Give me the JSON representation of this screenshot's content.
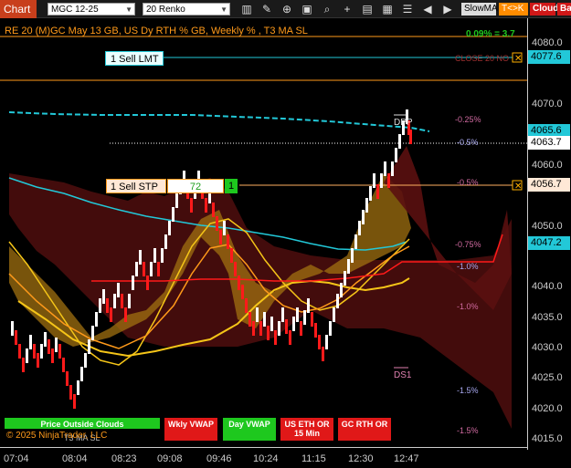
{
  "toolbar": {
    "title": "Chart",
    "instrument": "MGC 12-25",
    "bar_type": "20 Renko",
    "buttons": {
      "strategy": "SlowMA",
      "tk": "T<>K",
      "cloud": "Cloud",
      "bar": "Bar"
    }
  },
  "chart": {
    "header": "RE 20  (M)GC May 13 GB, US Dy RTH % GB, Weekly % , T3 MA SL",
    "top_right_value": "0.09% = 3.7",
    "copyright": "© 2025 NinjaTrader, LLC",
    "watermark": "T3 MA SL",
    "colors": {
      "up": "#ffffff",
      "down": "#ff1a1a",
      "cyan": "#22c8d8",
      "gold": "#f5c518",
      "orange": "#ff9a1a"
    }
  },
  "price_axis": {
    "ticks": [
      "4080.0",
      "4075.0",
      "4070.0",
      "4065.0",
      "4060.0",
      "4055.0",
      "4050.0",
      "4045.0",
      "4040.0",
      "4035.0",
      "4030.0",
      "4025.0",
      "4020.0",
      "4015.0"
    ],
    "tags": {
      "sell_lmt": "4077.6",
      "upper_cyan": "4065.6",
      "last": "4063.7",
      "sell_stp": "4056.7",
      "lower_cyan": "4047.2"
    }
  },
  "time_axis": {
    "ticks": [
      "07:04",
      "08:04",
      "08:23",
      "09:08",
      "09:46",
      "10:24",
      "11:15",
      "12:30",
      "12:47"
    ]
  },
  "orders": {
    "sell_lmt": {
      "label": "1 Sell LMT"
    },
    "sell_stp": {
      "label": "1 Sell STP",
      "ticks": "72",
      "qty": "1"
    }
  },
  "annotations": {
    "close_label": "CLOSE 20 NO",
    "dpp": "DPP",
    "ds1": "DS1",
    "pct": [
      "-0.25%",
      "-0.5%",
      "-0.5%",
      "-0.75%",
      "-1.0%",
      "-1.0%",
      "-1.5%",
      "-1.5%"
    ]
  },
  "trade_buttons": [
    {
      "label": "Price Outside Clouds",
      "color": "#1ec81e"
    },
    {
      "label": "Wkly VWAP",
      "color": "#e01818"
    },
    {
      "label": "Day VWAP",
      "color": "#1ec81e"
    },
    {
      "label": "US ETH OR 15 Min",
      "color": "#e01818"
    },
    {
      "label": "GC RTH OR",
      "color": "#e01818"
    }
  ]
}
